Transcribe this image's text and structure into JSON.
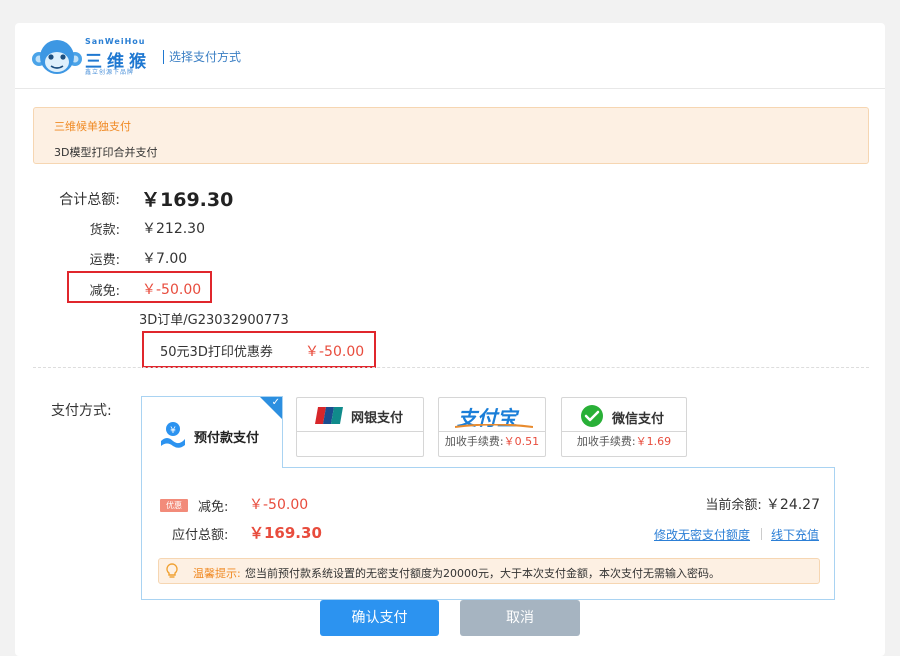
{
  "header": {
    "brand_small": "SanWeiHou",
    "brand_main": "三维猴",
    "brand_slogan": "鑫立创源下品牌",
    "subtitle": "选择支付方式"
  },
  "notice": {
    "line1": "三维候单独支付",
    "line2": "3D模型打印合并支付"
  },
  "summary": {
    "total_label": "合计总额:",
    "total_value": "￥169.30",
    "goods_label": "货款:",
    "goods_value": "￥212.30",
    "shipping_label": "运费:",
    "shipping_value": "￥7.00",
    "discount_label": "减免:",
    "discount_value": "￥-50.00",
    "order_number": "3D订单/G23032900773",
    "coupon_name": "50元3D打印优惠券",
    "coupon_value": "￥-50.00"
  },
  "payment": {
    "label": "支付方式:",
    "selected_tab": "预付款支付",
    "options": [
      {
        "name": "网银支付",
        "fee_label": "",
        "fee_value": ""
      },
      {
        "name": "支付宝",
        "fee_label": "加收手续费:",
        "fee_value": "￥0.51"
      },
      {
        "name": "微信支付",
        "fee_label": "加收手续费:",
        "fee_value": "￥1.69"
      }
    ],
    "unionpay_text": "UnionPay 银联"
  },
  "panel": {
    "badge": "优惠",
    "discount_label": "减免:",
    "discount_value": "￥-50.00",
    "due_label": "应付总额:",
    "due_value": "￥169.30",
    "balance_label": "当前余额:",
    "balance_value": "￥24.27",
    "link_modify": "修改无密支付额度",
    "link_topup": "线下充值",
    "tip_label": "温馨提示:",
    "tip_text": "您当前预付款系统设置的无密支付额度为20000元，大于本次支付金额，本次支付无需输入密码。"
  },
  "buttons": {
    "confirm": "确认支付",
    "cancel": "取消"
  },
  "colors": {
    "accent": "#2c93f0",
    "danger": "#e84c3d",
    "warning": "#f08a24"
  }
}
